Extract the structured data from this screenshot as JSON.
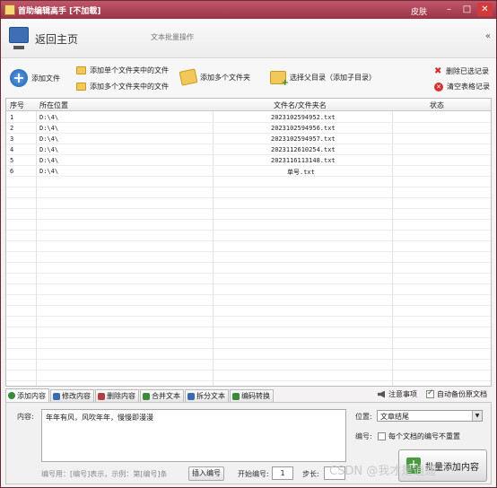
{
  "window": {
    "title": "首助编辑高手 [不加载]",
    "skin_label": "皮肤",
    "min": "–",
    "max": "□",
    "close": "✕"
  },
  "header": {
    "home_label": "返回主页",
    "subtitle": "文本批量操作",
    "collapse": "«"
  },
  "toolbar": {
    "add_file": "添加文件",
    "add_single_folder": "添加单个文件夹中的文件",
    "add_multi_folders_files": "添加多个文件夹中的文件",
    "add_multi_folders": "添加多个文件夹",
    "select_parent": "选择父目录（添加子目录）",
    "delete_selected": "删除已选记录",
    "clear_table": "清空表格记录"
  },
  "table": {
    "columns": [
      "序号",
      "所在位置",
      "文件名/文件夹名",
      "状态"
    ],
    "rows": [
      {
        "index": "1",
        "location": "D:\\4\\",
        "name": "2023102594952.txt",
        "status": ""
      },
      {
        "index": "2",
        "location": "D:\\4\\",
        "name": "2023102594956.txt",
        "status": ""
      },
      {
        "index": "3",
        "location": "D:\\4\\",
        "name": "2023102594957.txt",
        "status": ""
      },
      {
        "index": "4",
        "location": "D:\\4\\",
        "name": "2023112610254.txt",
        "status": ""
      },
      {
        "index": "5",
        "location": "D:\\4\\",
        "name": "2023116113148.txt",
        "status": ""
      },
      {
        "index": "6",
        "location": "D:\\4\\",
        "name": "单号.txt",
        "status": ""
      }
    ]
  },
  "tabs": [
    {
      "label": "添加内容",
      "color": "#3a8a3a"
    },
    {
      "label": "修改内容",
      "color": "#3a6ab0"
    },
    {
      "label": "删除内容",
      "color": "#b04040"
    },
    {
      "label": "合并文本",
      "color": "#3a8a3a"
    },
    {
      "label": "拆分文本",
      "color": "#3a6ab0"
    },
    {
      "label": "编码转换",
      "color": "#3a8a3a"
    }
  ],
  "right_tools": {
    "notes": "注意事项",
    "auto_backup": "自动备份原文档",
    "auto_backup_checked": true
  },
  "panel": {
    "content_label": "内容:",
    "content_value": "年年有风，风吹年年，慢慢即漫漫",
    "position_label": "位置:",
    "position_value": "文章结尾",
    "number_label": "编号:",
    "number_checkbox": "每个文档的编号不重置",
    "hint": "编号用：[编号]表示，示例：第[编号]条",
    "insert_number": "插入编号",
    "start_label": "开始编号:",
    "start_value": "1",
    "step_label": "步长:",
    "step_value": "",
    "run_button": "批量添加内容"
  },
  "watermark": "CSDN @我才是逍遥"
}
